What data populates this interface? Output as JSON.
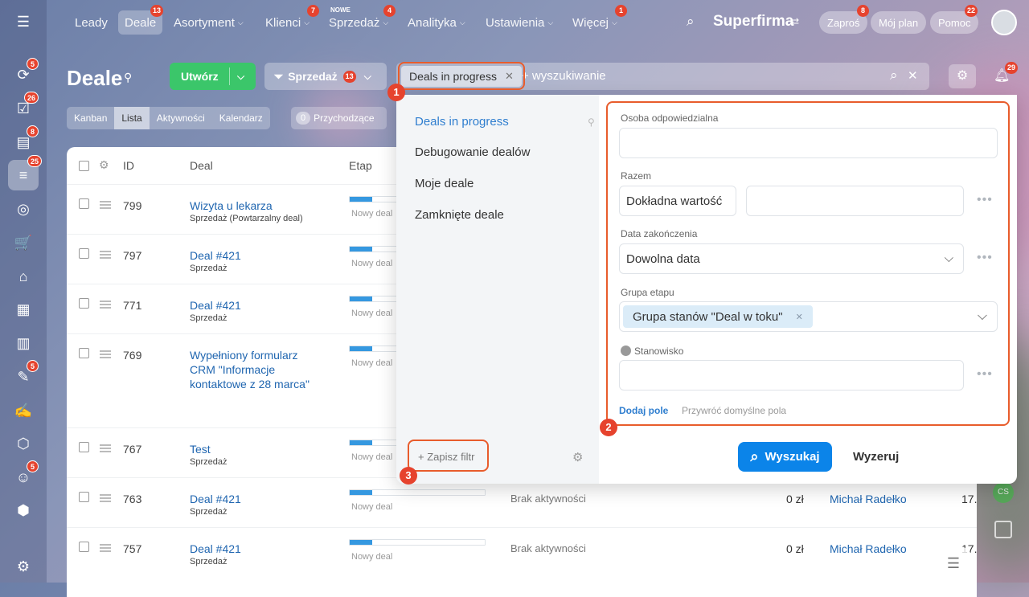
{
  "nav": {
    "leads": "Leady",
    "deals": "Deale",
    "deals_badge": "13",
    "assortment": "Asortyment",
    "clients": "Klienci",
    "clients_badge": "7",
    "sales": "Sprzedaż",
    "sales_new": "NOWE",
    "sales_badge": "4",
    "analytics": "Analityka",
    "settings": "Ustawienia",
    "more": "Więcej",
    "more_badge": "1"
  },
  "company": "Superfirma",
  "top_right": {
    "invite": "Zaproś",
    "invite_badge": "8",
    "plan": "Mój plan",
    "help": "Pomoc",
    "help_badge": "22",
    "bell_badge": "29"
  },
  "rail_badges": [
    "5",
    "26",
    "8",
    "25",
    "5",
    "5"
  ],
  "page": {
    "title": "Deale",
    "create": "Utwórz",
    "pipeline": "Sprzedaż",
    "pipeline_badge": "13",
    "search_placeholder": "+ wyszukiwanie"
  },
  "filter_chip": "Deals in progress",
  "views": [
    "Kanban",
    "Lista",
    "Aktywności",
    "Kalendarz"
  ],
  "incoming": {
    "count": "0",
    "label": "Przychodzące"
  },
  "table_headers": {
    "id": "ID",
    "deal": "Deal",
    "stage": "Etap"
  },
  "rows": [
    {
      "id": "799",
      "title": "Wizyta u lekarza",
      "sub": "Sprzedaż (Powtarzalny deal)",
      "stage": "Nowy deal"
    },
    {
      "id": "797",
      "title": "Deal #421",
      "sub": "Sprzedaż",
      "stage": "Nowy deal"
    },
    {
      "id": "771",
      "title": "Deal #421",
      "sub": "Sprzedaż",
      "stage": "Nowy deal"
    },
    {
      "id": "769",
      "title": "Wypełniony formularz CRM \"Informacje kontaktowe z 28 marca\"",
      "sub": "",
      "stage": "Nowy deal"
    },
    {
      "id": "767",
      "title": "Test",
      "sub": "Sprzedaż",
      "stage": "Nowy deal"
    },
    {
      "id": "763",
      "title": "Deal #421",
      "sub": "Sprzedaż",
      "stage": "Nowy deal",
      "activity": "Brak aktywności",
      "sum": "0 zł",
      "person": "Michał Radełko",
      "date": "17."
    },
    {
      "id": "757",
      "title": "Deal #421",
      "sub": "Sprzedaż",
      "stage": "Nowy deal",
      "activity": "Brak aktywności",
      "sum": "0 zł",
      "person": "Michał Radełko",
      "date": "17."
    }
  ],
  "presets": [
    "Deals in progress",
    "Debugowanie dealów",
    "Moje deale",
    "Zamknięte deale"
  ],
  "save_filter": "+ Zapisz filtr",
  "fields": {
    "responsible": "Osoba odpowiedzialna",
    "total": "Razem",
    "total_select": "Dokładna wartość",
    "close_date": "Data zakończenia",
    "close_date_select": "Dowolna data",
    "stage_group": "Grupa etapu",
    "stage_group_tag": "Grupa stanów \"Deal w toku\"",
    "position": "Stanowisko"
  },
  "add_field": "Dodaj pole",
  "restore": "Przywróć domyślne pola",
  "search_btn": "Wyszukaj",
  "reset_btn": "Wyzeruj",
  "markers": [
    "1",
    "2",
    "3"
  ],
  "side_avatar": "CS"
}
